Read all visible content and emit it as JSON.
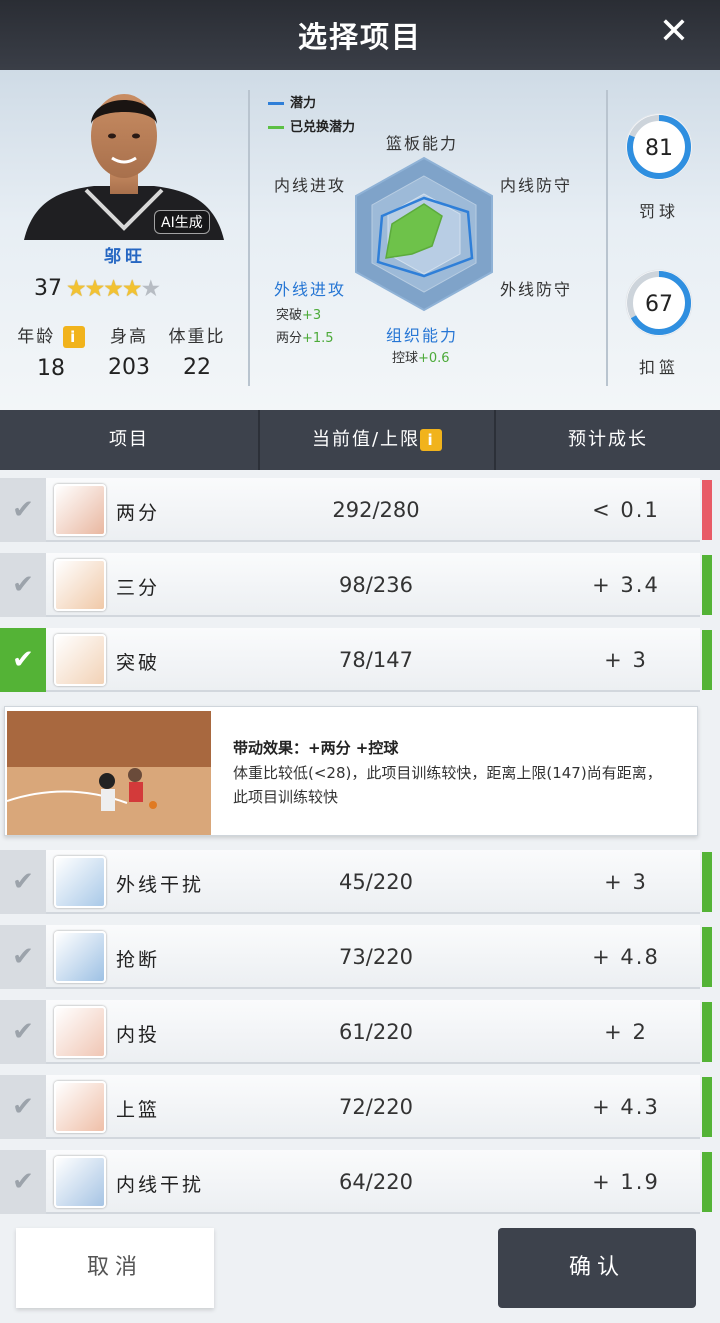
{
  "header": {
    "title": "选择项目",
    "close_label": "✕"
  },
  "player": {
    "name": "邬旺",
    "ai_badge": "AI生成",
    "rating": "37",
    "stars_filled": 4,
    "stars_total": 5,
    "stats": [
      {
        "label": "年龄",
        "value": "18",
        "info": "i"
      },
      {
        "label": "身高",
        "value": "203"
      },
      {
        "label": "体重比",
        "value": "22"
      }
    ]
  },
  "legend": {
    "potential": "潜力",
    "redeemed": "已兑换潜力",
    "potential_color": "#2f7fd8",
    "redeemed_color": "#5cc045"
  },
  "radar": {
    "top": "篮板能力",
    "top_left": "内线进攻",
    "top_right": "内线防守",
    "bottom_left": "外线进攻",
    "bottom_right": "外线防守",
    "bottom": "组织能力",
    "sub_left": [
      {
        "label": "突破",
        "bonus": "+3"
      },
      {
        "label": "两分",
        "bonus": "+1.5"
      }
    ],
    "sub_bottom": {
      "label": "控球",
      "bonus": "+0.6"
    }
  },
  "rings": [
    {
      "value": "81",
      "label": "罚球",
      "fraction": 0.81
    },
    {
      "value": "67",
      "label": "扣篮",
      "fraction": 0.67
    }
  ],
  "table": {
    "col_item": "项目",
    "col_current": "当前值/上限",
    "col_current_info": "i",
    "col_growth": "预计成长"
  },
  "rows": [
    {
      "name": "两分",
      "value": "292/280",
      "growth": "< 0.1",
      "selected": false,
      "side": "red"
    },
    {
      "name": "三分",
      "value": "98/236",
      "growth": "+ 3.4",
      "selected": false,
      "side": "green"
    },
    {
      "name": "突破",
      "value": "78/147",
      "growth": "+ 3",
      "selected": true,
      "side": "green"
    },
    {
      "name": "外线干扰",
      "value": "45/220",
      "growth": "+ 3",
      "selected": false,
      "side": "green"
    },
    {
      "name": "抢断",
      "value": "73/220",
      "growth": "+ 4.8",
      "selected": false,
      "side": "green"
    },
    {
      "name": "内投",
      "value": "61/220",
      "growth": "+ 2",
      "selected": false,
      "side": "green"
    },
    {
      "name": "上篮",
      "value": "72/220",
      "growth": "+ 4.3",
      "selected": false,
      "side": "green"
    },
    {
      "name": "内线干扰",
      "value": "64/220",
      "growth": "+ 1.9",
      "selected": false,
      "side": "green"
    }
  ],
  "effect": {
    "title": "带动效果：+两分  +控球",
    "desc": "体重比较低(<28)，此项目训练较快，距离上限(147)尚有距离，此项目训练较快"
  },
  "buttons": {
    "cancel": "取消",
    "confirm": "确认"
  }
}
